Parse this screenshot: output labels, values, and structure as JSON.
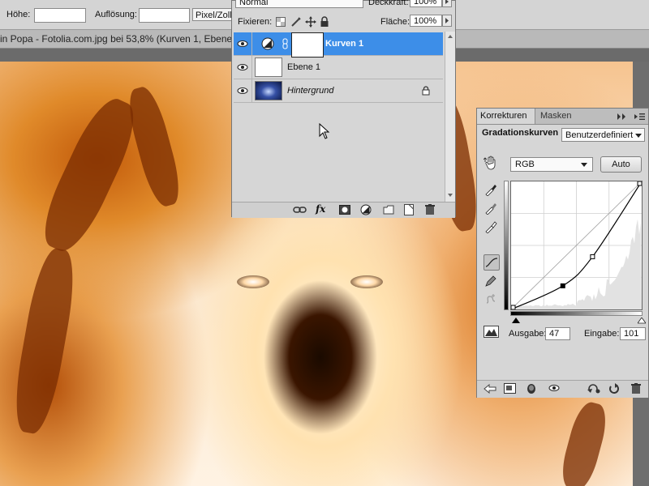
{
  "options_bar": {
    "height_label": "Höhe:",
    "height_value": "",
    "resolution_label": "Auflösung:",
    "resolution_value": "",
    "unit_value": "Pixel/Zoll"
  },
  "document": {
    "title": "in Popa - Fotolia.com.jpg bei 53,8% (Kurven 1, Ebenen"
  },
  "layers_panel": {
    "blend_mode": "Normal",
    "opacity_label": "Deckkraft:",
    "opacity_value": "100%",
    "lock_label": "Fixieren:",
    "fill_label": "Fläche:",
    "fill_value": "100%",
    "layers": [
      {
        "name": "Kurven 1",
        "selected": true,
        "italic": false
      },
      {
        "name": "Ebene 1",
        "selected": false,
        "italic": false
      },
      {
        "name": "Hintergrund",
        "selected": false,
        "italic": true
      }
    ],
    "selected_color": "#3d8ee8",
    "footer_fx": "fx"
  },
  "adjustments_panel": {
    "tabs": [
      {
        "label": "Korrekturen",
        "active": true
      },
      {
        "label": "Masken",
        "active": false
      }
    ],
    "title": "Gradationskurven",
    "preset_value": "Benutzerdefiniert",
    "channel_value": "RGB",
    "auto_label": "Auto",
    "output_label": "Ausgabe:",
    "output_value": "47",
    "input_label": "Eingabe:",
    "input_value": "101",
    "curve": {
      "points": [
        [
          0,
          0
        ],
        [
          101,
          47
        ],
        [
          159,
          105
        ],
        [
          255,
          255
        ]
      ]
    }
  }
}
